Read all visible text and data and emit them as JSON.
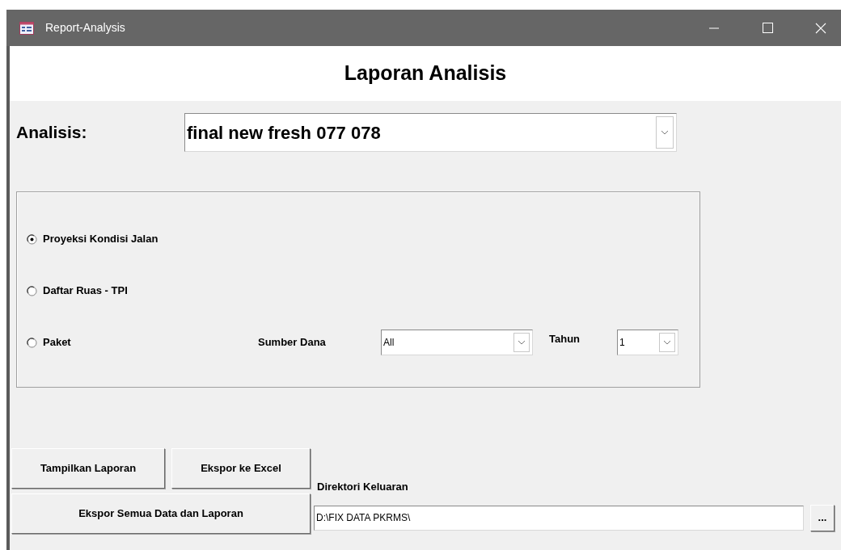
{
  "window": {
    "title": "Report-Analysis"
  },
  "heading": "Laporan Analisis",
  "analisis": {
    "label": "Analisis:",
    "value": "final new fresh 077 078"
  },
  "options": [
    {
      "label": "Proyeksi Kondisi Jalan",
      "selected": true
    },
    {
      "label": "Daftar Ruas - TPI",
      "selected": false
    },
    {
      "label": "Paket",
      "selected": false
    }
  ],
  "sumber_dana": {
    "label": "Sumber Dana",
    "value": "All"
  },
  "tahun": {
    "label": "Tahun",
    "value": "1"
  },
  "buttons": {
    "tampilkan": "Tampilkan Laporan",
    "excel": "Ekspor ke Excel",
    "semua": "Ekspor Semua Data dan Laporan",
    "browse": "..."
  },
  "direktori": {
    "label": "Direktori Keluaran",
    "value": "D:\\FIX DATA PKRMS\\"
  }
}
